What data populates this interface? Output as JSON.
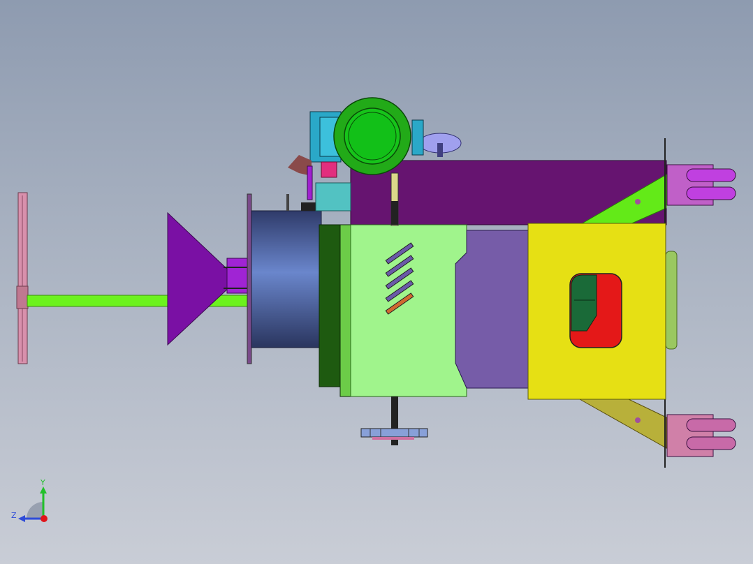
{
  "viewport": {
    "background_top": "#8e9bb0",
    "background_bottom": "#c9cdd6"
  },
  "model": {
    "parts": [
      "hand-wheel",
      "drive-shaft",
      "feed-hopper",
      "drum-housing",
      "gear-housing",
      "access-cover",
      "motor",
      "gearbox",
      "top-frame",
      "front-panel",
      "side-frame",
      "inspection-window",
      "caster-wheel",
      "caster-wheel",
      "spur-gear"
    ]
  },
  "triad": {
    "y_label": "Y",
    "z_label": "Z",
    "y_color": "#22c02a",
    "z_color": "#2e4bd8",
    "x_color": "#e0141a"
  }
}
